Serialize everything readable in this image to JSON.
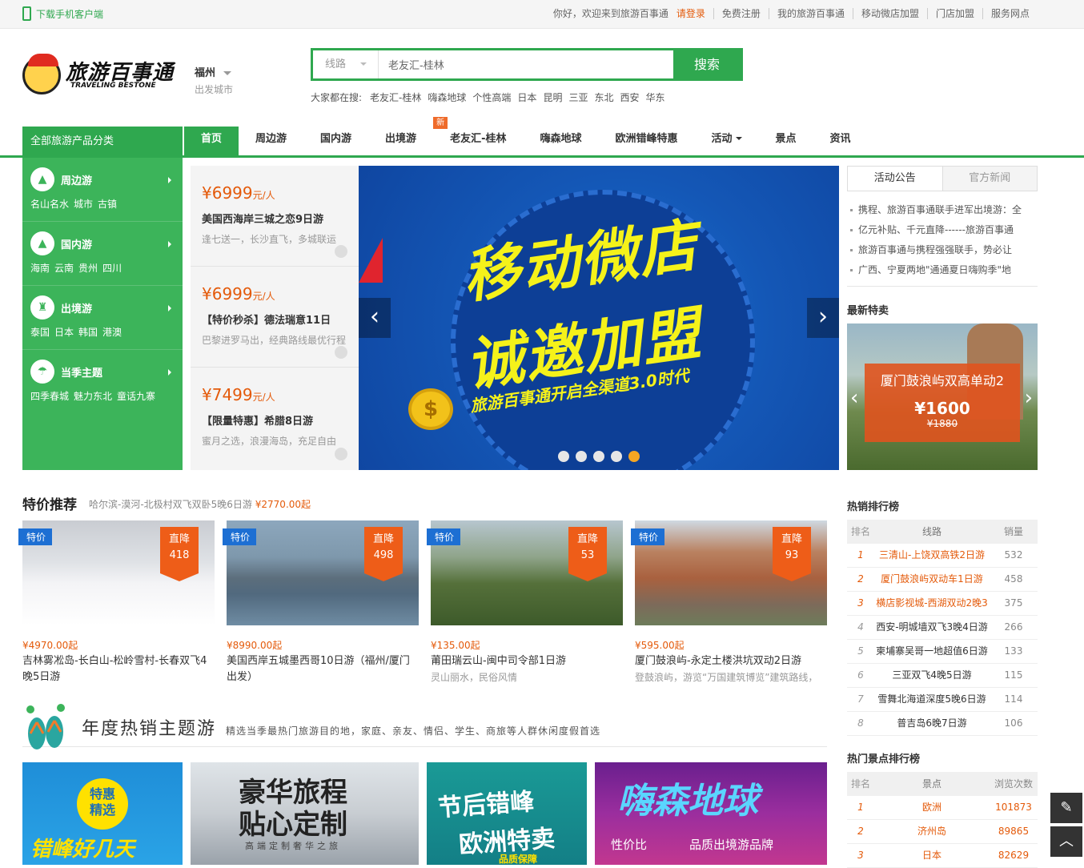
{
  "topbar": {
    "download": "下载手机客户端",
    "welcome": "你好，欢迎来到旅游百事通",
    "login": "请登录",
    "links": [
      "免费注册",
      "我的旅游百事通",
      "移动微店加盟",
      "门店加盟",
      "服务网点"
    ]
  },
  "header": {
    "logo_cn": "旅游百事通",
    "logo_en": "TRAVELING BESTONE",
    "city": "福州",
    "city_label": "出发城市",
    "search_type": "线路",
    "search_value": "老友汇-桂林",
    "search_button": "搜索",
    "hot_label": "大家都在搜:",
    "hot_words": [
      "老友汇-桂林",
      "嗨森地球",
      "个性高端",
      "日本",
      "昆明",
      "三亚",
      "东北",
      "西安",
      "华东"
    ]
  },
  "nav": {
    "all_categories": "全部旅游产品分类",
    "items": [
      "首页",
      "周边游",
      "国内游",
      "出境游",
      "老友汇-桂林",
      "嗨森地球",
      "欧洲错峰特惠",
      "活动",
      "景点",
      "资讯"
    ],
    "new_badge": "新"
  },
  "categories": [
    {
      "title": "周边游",
      "icon": "mountain-icon",
      "subs": [
        "名山名水",
        "城市",
        "古镇"
      ]
    },
    {
      "title": "国内游",
      "icon": "mountain-icon",
      "subs": [
        "海南",
        "云南",
        "贵州",
        "四川"
      ]
    },
    {
      "title": "出境游",
      "icon": "tower-icon",
      "subs": [
        "泰国",
        "日本",
        "韩国",
        "港澳"
      ]
    },
    {
      "title": "当季主题",
      "icon": "palm-icon",
      "subs": [
        "四季春城",
        "魅力东北",
        "童话九寨"
      ]
    }
  ],
  "promos": [
    {
      "price": "¥6999",
      "unit": "元/人",
      "name": "美国西海岸三城之恋9日游",
      "desc": "逢七送一，长沙直飞，多城联运"
    },
    {
      "price": "¥6999",
      "unit": "元/人",
      "name": "【特价秒杀】德法瑞意11日",
      "desc": "巴黎进罗马出，经典路线最优行程"
    },
    {
      "price": "¥7499",
      "unit": "元/人",
      "name": "【限量特惠】希腊8日游",
      "desc": "蜜月之选，浪漫海岛，充足自由"
    }
  ],
  "banner": {
    "line1": "移动微店",
    "line2": "诚邀加盟",
    "line3": "旅游百事通开启全渠道3.0时代",
    "coin": "$",
    "slides": 5,
    "active_slide": 5
  },
  "notice": {
    "tabs": [
      "活动公告",
      "官方新闻"
    ],
    "items": [
      "携程、旅游百事通联手进军出境游：全",
      "亿元补贴、千元直降------旅游百事通",
      "旅游百事通与携程强强联手，势必让",
      "广西、宁夏两地\"通通夏日嗨购季\"地"
    ]
  },
  "latest": {
    "title": "最新特卖",
    "name": "厦门鼓浪屿双高单动2",
    "price": "¥1600",
    "old_price": "¥1880"
  },
  "specials": {
    "title": "特价推荐",
    "sub": "哈尔滨-漠河-北极村双飞双卧5晚6日游",
    "sub_price": "¥2770.00起",
    "tag": "特价",
    "drop_label": "直降",
    "items": [
      {
        "drop": "418",
        "price": "¥4970.00起",
        "name": "吉林雾凇岛-长白山-松岭雪村-长春双飞4晚5日游",
        "desc": ""
      },
      {
        "drop": "498",
        "price": "¥8990.00起",
        "name": "美国西岸五城墨西哥10日游（福州/厦门出发）",
        "desc": ""
      },
      {
        "drop": "53",
        "price": "¥135.00起",
        "name": "莆田瑞云山-闽中司令部1日游",
        "desc": "灵山丽水，民俗风情"
      },
      {
        "drop": "93",
        "price": "¥595.00起",
        "name": "厦门鼓浪屿-永定土楼洪坑双动2日游",
        "desc": "登鼓浪屿，游览“万国建筑博览”建筑路线，"
      }
    ]
  },
  "annual": {
    "title": "年度热销主题游",
    "sub": "精选当季最热门旅游目的地，家庭、亲友、情侣、学生、商旅等人群休闲度假首选",
    "themes": [
      {
        "a": "特惠",
        "b": "精选",
        "c": "错峰好几天"
      },
      {
        "a": "豪华旅程",
        "b": "贴心定制",
        "c": "高端定制奢华之旅"
      },
      {
        "a": "节后错峰",
        "b": "欧洲特卖",
        "c": "品质保障"
      },
      {
        "a": "嗨森地球",
        "b": "性价比",
        "c": "品质出境游品牌"
      }
    ]
  },
  "hot_sales": {
    "title": "热销排行榜",
    "cols": [
      "排名",
      "线路",
      "销量"
    ],
    "rows": [
      [
        "1",
        "三清山-上饶双高铁2日游",
        "532"
      ],
      [
        "2",
        "厦门鼓浪屿双动车1日游",
        "458"
      ],
      [
        "3",
        "横店影视城-西湖双动2晚3",
        "375"
      ],
      [
        "4",
        "西安-明城墙双飞3晚4日游",
        "266"
      ],
      [
        "5",
        "柬埔寨吴哥一地超值6日游",
        "133"
      ],
      [
        "6",
        "三亚双飞4晚5日游",
        "115"
      ],
      [
        "7",
        "雪舞北海道深度5晚6日游",
        "114"
      ],
      [
        "8",
        "普吉岛6晚7日游",
        "106"
      ]
    ]
  },
  "hot_spots": {
    "title": "热门景点排行榜",
    "cols": [
      "排名",
      "景点",
      "浏览次数"
    ],
    "rows": [
      [
        "1",
        "欧洲",
        "101873"
      ],
      [
        "2",
        "济州岛",
        "89865"
      ],
      [
        "3",
        "日本",
        "82629"
      ]
    ]
  },
  "fixed": {
    "edit": "✎",
    "top": "︿"
  }
}
